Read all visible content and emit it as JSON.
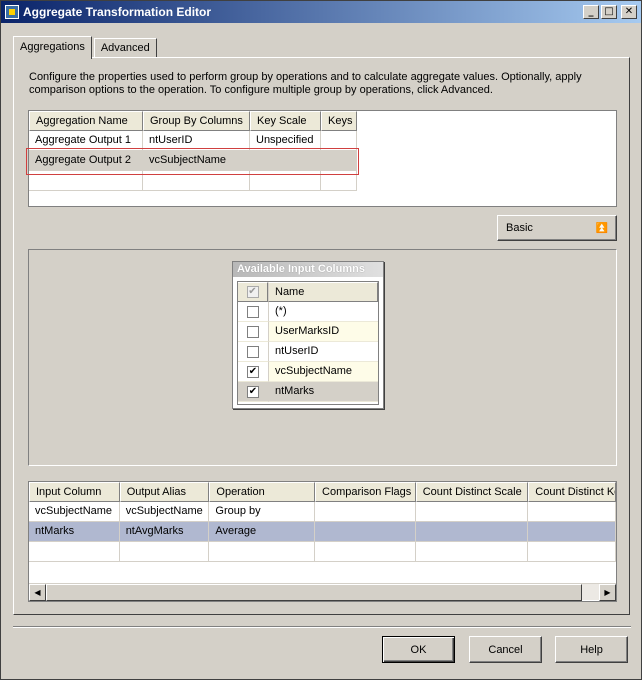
{
  "window": {
    "title": "Aggregate Transformation Editor"
  },
  "title_buttons": {
    "minimize": "_",
    "maximize": "□",
    "close": "✕"
  },
  "tabs": [
    {
      "label": "Aggregations",
      "active": true
    },
    {
      "label": "Advanced",
      "active": false
    }
  ],
  "description": "Configure the properties used to perform group by operations and to calculate aggregate values. Optionally, apply comparison options to the operation. To configure multiple group by operations, click Advanced.",
  "aggregations_table": {
    "headers": [
      "Aggregation Name",
      "Group By Columns",
      "Key Scale",
      "Keys"
    ],
    "rows": [
      [
        "Aggregate Output 1",
        "ntUserID",
        "Unspecified",
        ""
      ],
      [
        "Aggregate Output 2",
        "vcSubjectName",
        "",
        ""
      ],
      [
        "",
        "",
        "",
        ""
      ]
    ]
  },
  "basic_button": {
    "label": "Basic",
    "icon": "double-up-arrow-icon",
    "glyph": "⏫"
  },
  "available_columns": {
    "title": "Available Input Columns",
    "header": "Name",
    "rows": [
      {
        "name": "(*)",
        "checked": false
      },
      {
        "name": "UserMarksID",
        "checked": false
      },
      {
        "name": "ntUserID",
        "checked": false
      },
      {
        "name": "vcSubjectName",
        "checked": true
      },
      {
        "name": "ntMarks",
        "checked": true
      }
    ],
    "check_glyph": "✔"
  },
  "operations_table": {
    "headers": [
      "Input Column",
      "Output Alias",
      "Operation",
      "Comparison Flags",
      "Count Distinct Scale",
      "Count Distinct Keys"
    ],
    "rows": [
      [
        "vcSubjectName",
        "vcSubjectName",
        "Group by",
        "",
        "",
        ""
      ],
      [
        "ntMarks",
        "ntAvgMarks",
        "Average",
        "",
        "",
        ""
      ],
      [
        "",
        "",
        "",
        "",
        "",
        ""
      ]
    ]
  },
  "scroll_glyphs": {
    "left": "◀",
    "right": "▶"
  },
  "footer": {
    "ok": "OK",
    "cancel": "Cancel",
    "help": "Help"
  },
  "colors": {
    "title_start": "#0a246a",
    "title_end": "#a6caf0",
    "selection": "#b0b8d0",
    "highlight_outline": "#d04040"
  }
}
